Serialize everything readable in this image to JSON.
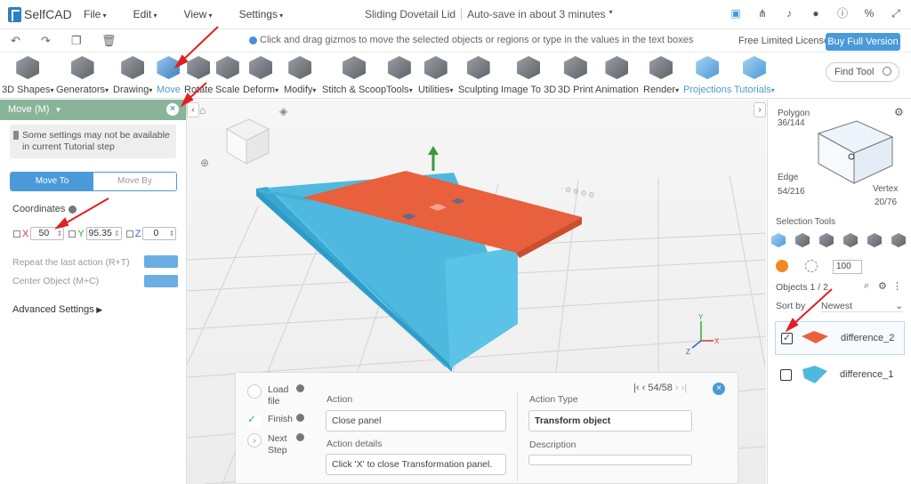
{
  "app": {
    "name": "SelfCAD",
    "doc_title": "Sliding Dovetail Lid",
    "autosave": "Auto-save in about 3 minutes"
  },
  "menus": [
    "File",
    "Edit",
    "View",
    "Settings"
  ],
  "hint": "Click and drag gizmos to move the selected objects or regions or type in the values in the text boxes",
  "license": "Free Limited License",
  "buy": "Buy Full Version",
  "tools": [
    "3D Shapes",
    "Generators",
    "Drawing",
    "Move",
    "Rotate",
    "Scale",
    "Deform",
    "Modify",
    "Stitch & Scoop",
    "Tools",
    "Utilities",
    "Sculpting",
    "Image To 3D",
    "3D Print",
    "Animation",
    "Render",
    "Projections",
    "Tutorials"
  ],
  "find_tool": "Find Tool",
  "panel": {
    "title": "Move (M)",
    "warning": "Some settings may not be available in current Tutorial step",
    "move_to": "Move To",
    "move_by": "Move By",
    "coordinates": "Coordinates",
    "x": "50",
    "y": "95.35",
    "z": "0",
    "x_label": "X",
    "y_label": "Y",
    "z_label": "Z",
    "repeat": "Repeat the last action (R+T)",
    "center": "Center Object (M+C)",
    "advanced": "Advanced Settings"
  },
  "right": {
    "polygon": "Polygon",
    "polygon_count": "36/144",
    "edge": "Edge",
    "edge_count": "54/216",
    "vertex": "Vertex",
    "vertex_count": "20/76",
    "selection_tools": "Selection Tools",
    "size": "100",
    "objects": "Objects 1 / 2",
    "sort_by": "Sort by",
    "sort_value": "Newest",
    "items": [
      {
        "name": "difference_2",
        "checked": "✓"
      },
      {
        "name": "difference_1",
        "checked": ""
      }
    ]
  },
  "tutorial": {
    "steps": [
      "Load file",
      "Finish",
      "Next Step"
    ],
    "pager": "54/58",
    "action_label": "Action",
    "action": "Close panel",
    "details_label": "Action details",
    "details": "Click 'X' to close Transformation panel.",
    "type_label": "Action Type",
    "type": "Transform object",
    "desc_label": "Description",
    "desc": ""
  },
  "colors": {
    "accent": "#4a9ad9",
    "panel_header": "#8ab49a",
    "lid": "#e8603c",
    "box": "#5bc4e6"
  }
}
